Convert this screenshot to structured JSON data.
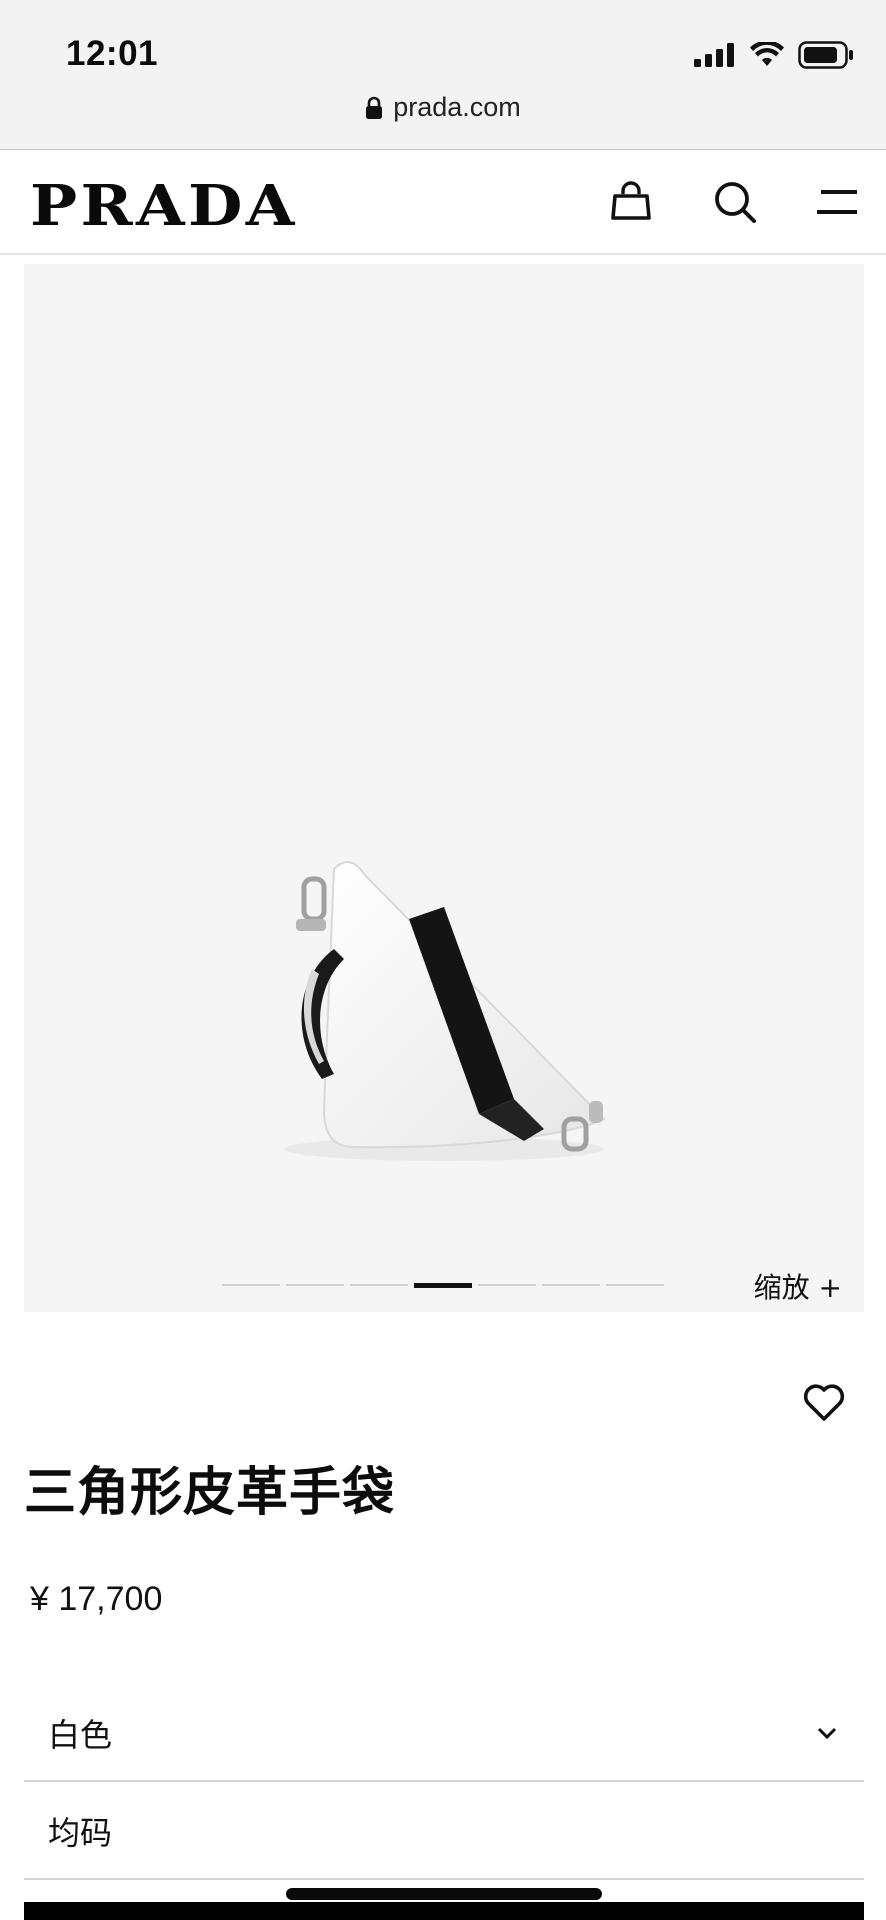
{
  "status_bar": {
    "time": "12:01"
  },
  "browser": {
    "url": "prada.com"
  },
  "header": {
    "logo_text": "PRADA",
    "icons": [
      "shopping-bag-icon",
      "search-icon",
      "menu-icon"
    ]
  },
  "gallery": {
    "slide_count": 7,
    "active_slide": 4,
    "zoom_label": "缩放 +"
  },
  "product": {
    "title": "三角形皮革手袋",
    "price": "¥ 17,700",
    "color_option": "白色",
    "size_option": "均码"
  },
  "colors": {
    "gallery_bg": "#f5f5f5",
    "text": "#111111",
    "divider": "#d4d4d4"
  }
}
